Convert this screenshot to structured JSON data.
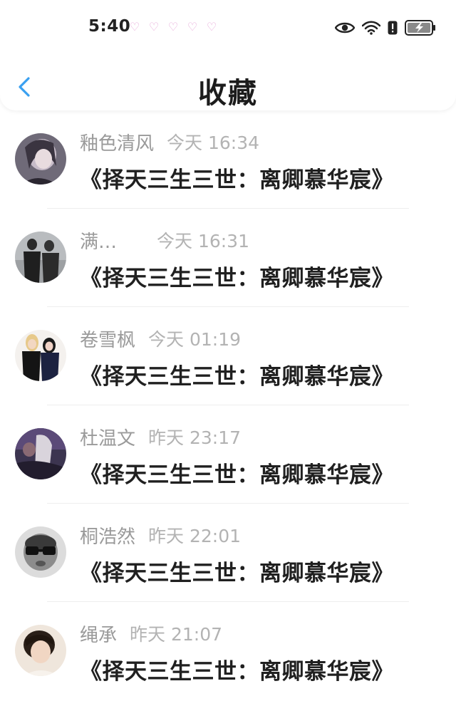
{
  "status_bar": {
    "time": "5:40",
    "hearts": [
      "♡",
      "♡",
      "♡",
      "♡",
      "♡"
    ]
  },
  "header": {
    "title": "收藏",
    "back_icon": "chevron-left-icon"
  },
  "colors": {
    "accent": "#3aa0f0",
    "name_gray": "#9a9a9a",
    "time_gray": "#b3b3b3",
    "title_text": "#202020"
  },
  "items": [
    {
      "name": "釉色清风",
      "time": "今天 16:34",
      "title": "《择天三生三世：离卿慕华宸》"
    },
    {
      "name": "满…",
      "time": "今天 16:31",
      "title": "《择天三生三世：离卿慕华宸》"
    },
    {
      "name": "卷雪枫",
      "time": "今天 01:19",
      "title": "《择天三生三世：离卿慕华宸》"
    },
    {
      "name": "杜温文",
      "time": "昨天 23:17",
      "title": "《择天三生三世：离卿慕华宸》"
    },
    {
      "name": "桐浩然",
      "time": "昨天 22:01",
      "title": "《择天三生三世：离卿慕华宸》"
    },
    {
      "name": "绳承",
      "time": "昨天 21:07",
      "title": "《择天三生三世：离卿慕华宸》"
    }
  ]
}
